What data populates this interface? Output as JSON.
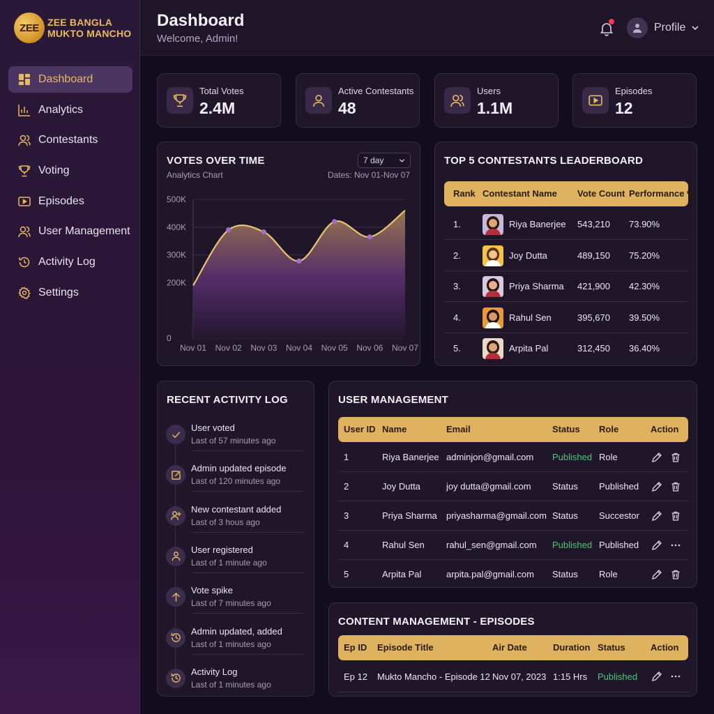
{
  "brand": {
    "logo_text": "ZEE",
    "line1": "ZEE BANGLA",
    "line2": "MUKTO MANCHO"
  },
  "sidebar": {
    "items": [
      {
        "label": "Dashboard",
        "icon": "dashboard-grid-icon"
      },
      {
        "label": "Analytics",
        "icon": "bar-chart-icon"
      },
      {
        "label": "Contestants",
        "icon": "users-icon"
      },
      {
        "label": "Voting",
        "icon": "trophy-icon"
      },
      {
        "label": "Episodes",
        "icon": "play-icon"
      },
      {
        "label": "User Management",
        "icon": "users-icon"
      },
      {
        "label": "Activity Log",
        "icon": "history-icon"
      },
      {
        "label": "Settings",
        "icon": "gear-icon"
      }
    ]
  },
  "header": {
    "title": "Dashboard",
    "welcome": "Welcome, Admin!",
    "profile_label": "Profile"
  },
  "stats": [
    {
      "label": "Total Votes",
      "value": "2.4M",
      "icon": "trophy-icon"
    },
    {
      "label": "Active Contestants",
      "value": "48",
      "icon": "user-icon"
    },
    {
      "label": "Users",
      "value": "1.1M",
      "icon": "users-icon"
    },
    {
      "label": "Episodes",
      "value": "12",
      "icon": "play-icon"
    }
  ],
  "votes_chart": {
    "title": "VOTES OVER TIME",
    "subtitle": "Analytics Chart",
    "range_select": "7 day",
    "dates": "Dates: Nov 01-Nov 07"
  },
  "chart_data": {
    "type": "area",
    "x": [
      "Nov 01",
      "Nov 02",
      "Nov 03",
      "Nov 04",
      "Nov 05",
      "Nov 06",
      "Nov 07"
    ],
    "y_ticks": [
      "500K",
      "400K",
      "300K",
      "200K",
      "0"
    ],
    "series": [
      {
        "values": [
          190000,
          390000,
          383000,
          278000,
          420000,
          365000,
          460000
        ]
      }
    ],
    "ylim": [
      0,
      500000
    ],
    "grid": true,
    "colors": {
      "line": "#e9c46f",
      "fill_top": "#8a6a4a",
      "fill_bottom": "#2a1836",
      "point": "#a070c8"
    }
  },
  "leaderboard": {
    "title": "TOP 5 CONTESTANTS LEADERBOARD",
    "headers": [
      "Rank",
      "Contestant Name",
      "Vote Count",
      "Performance %"
    ],
    "rows": [
      {
        "rank": "1.",
        "name": "Riya Banerjee",
        "votes": "543,210",
        "perf": "73.90%"
      },
      {
        "rank": "2.",
        "name": "Joy Dutta",
        "votes": "489,150",
        "perf": "75.20%"
      },
      {
        "rank": "3.",
        "name": "Priya Sharma",
        "votes": "421,900",
        "perf": "42.30%"
      },
      {
        "rank": "4.",
        "name": "Rahul Sen",
        "votes": "395,670",
        "perf": "39.50%"
      },
      {
        "rank": "5.",
        "name": "Arpita Pal",
        "votes": "312,450",
        "perf": "36.40%"
      }
    ]
  },
  "activity": {
    "title": "RECENT ACTIVITY LOG",
    "items": [
      {
        "title": "User voted",
        "time": "Last of 57 minutes ago",
        "icon": "check-icon"
      },
      {
        "title": "Admin updated episode",
        "time": "Last of 120 minutes ago",
        "icon": "edit-icon"
      },
      {
        "title": "New contestant added",
        "time": "Last of 3 hous ago",
        "icon": "user-plus-icon"
      },
      {
        "title": "User registered",
        "time": "Last of 1 minute ago",
        "icon": "user-icon"
      },
      {
        "title": "Vote spike",
        "time": "Last of 7 minutes ago",
        "icon": "arrow-up-icon"
      },
      {
        "title": "Admin updated, added",
        "time": "Last of 1 minutes ago",
        "icon": "history-icon"
      },
      {
        "title": "Activity Log",
        "time": "Last of 1 minutes ago",
        "icon": "history-icon"
      }
    ]
  },
  "users": {
    "title": "USER MANAGEMENT",
    "headers": [
      "User ID",
      "Name",
      "Email",
      "Status",
      "Role",
      "Action"
    ],
    "rows": [
      {
        "id": "1",
        "name": "Riya Banerjee",
        "email": "adminjon@gmail.com",
        "status": "Published",
        "role": "Role",
        "second_action": "trash-icon"
      },
      {
        "id": "2",
        "name": "Joy Dutta",
        "email": "joy dutta@gmail.com",
        "status": "Status",
        "role": "Published",
        "second_action": "trash-icon"
      },
      {
        "id": "3",
        "name": "Priya Sharma",
        "email": "priyasharma@gmail.com",
        "status": "Status",
        "role": "Succestor",
        "second_action": "trash-icon"
      },
      {
        "id": "4",
        "name": "Rahul Sen",
        "email": "rahul_sen@gmail.com",
        "status": "Published",
        "role": "Published",
        "second_action": "more-icon"
      },
      {
        "id": "5",
        "name": "Arpita Pal",
        "email": "arpita.pal@gmail.com",
        "status": "Status",
        "role": "Role",
        "second_action": "trash-icon"
      }
    ]
  },
  "episodes": {
    "title": "CONTENT MANAGEMENT - EPISODES",
    "headers": [
      "Ep ID",
      "Episode Title",
      "Air Date",
      "Duration",
      "Status",
      "Action"
    ],
    "rows": [
      {
        "id": "Ep 12",
        "title": "Mukto Mancho - Episode 12",
        "date": "Nov 07, 2023",
        "duration": "1:15 Hrs",
        "status": "Published"
      }
    ]
  },
  "colors": {
    "accent_gold": "#deb25e",
    "published_green": "#4fc57a",
    "sidebar_active": "#4a3660",
    "card_bg": "#1f1729"
  }
}
